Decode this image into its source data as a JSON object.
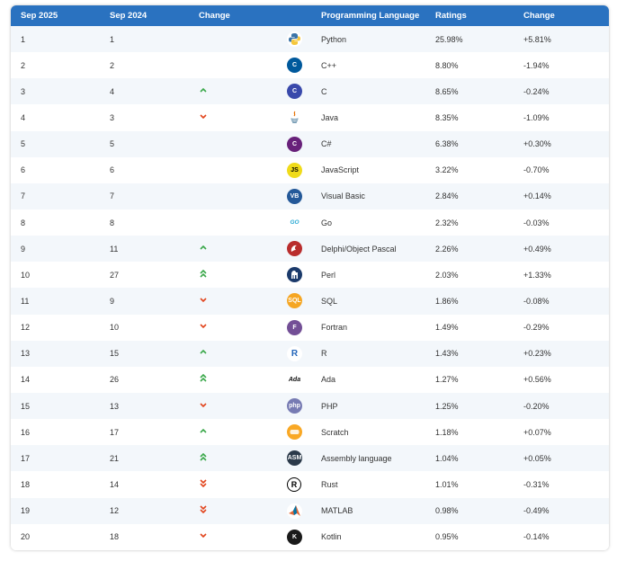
{
  "headers": {
    "sep2025": "Sep 2025",
    "sep2024": "Sep 2024",
    "change": "Change",
    "language": "Programming Language",
    "ratings": "Ratings",
    "ratings_change": "Change"
  },
  "colors": {
    "header_bg": "#2a72c0",
    "up": "#3aa84a",
    "down": "#e2441c"
  },
  "rows": [
    {
      "rank": "1",
      "prev": "1",
      "trend": "none",
      "icon": "python-icon",
      "lang": "Python",
      "rating": "25.98%",
      "change": "+5.81%"
    },
    {
      "rank": "2",
      "prev": "2",
      "trend": "none",
      "icon": "cpp-icon",
      "lang": "C++",
      "rating": "8.80%",
      "change": "-1.94%"
    },
    {
      "rank": "3",
      "prev": "4",
      "trend": "up",
      "icon": "c-icon",
      "lang": "C",
      "rating": "8.65%",
      "change": "-0.24%"
    },
    {
      "rank": "4",
      "prev": "3",
      "trend": "down",
      "icon": "java-icon",
      "lang": "Java",
      "rating": "8.35%",
      "change": "-1.09%"
    },
    {
      "rank": "5",
      "prev": "5",
      "trend": "none",
      "icon": "csharp-icon",
      "lang": "C#",
      "rating": "6.38%",
      "change": "+0.30%"
    },
    {
      "rank": "6",
      "prev": "6",
      "trend": "none",
      "icon": "javascript-icon",
      "lang": "JavaScript",
      "rating": "3.22%",
      "change": "-0.70%"
    },
    {
      "rank": "7",
      "prev": "7",
      "trend": "none",
      "icon": "visual-basic-icon",
      "lang": "Visual Basic",
      "rating": "2.84%",
      "change": "+0.14%"
    },
    {
      "rank": "8",
      "prev": "8",
      "trend": "none",
      "icon": "go-icon",
      "lang": "Go",
      "rating": "2.32%",
      "change": "-0.03%"
    },
    {
      "rank": "9",
      "prev": "11",
      "trend": "up",
      "icon": "delphi-icon",
      "lang": "Delphi/Object Pascal",
      "rating": "2.26%",
      "change": "+0.49%"
    },
    {
      "rank": "10",
      "prev": "27",
      "trend": "up2",
      "icon": "perl-icon",
      "lang": "Perl",
      "rating": "2.03%",
      "change": "+1.33%"
    },
    {
      "rank": "11",
      "prev": "9",
      "trend": "down",
      "icon": "sql-icon",
      "lang": "SQL",
      "rating": "1.86%",
      "change": "-0.08%"
    },
    {
      "rank": "12",
      "prev": "10",
      "trend": "down",
      "icon": "fortran-icon",
      "lang": "Fortran",
      "rating": "1.49%",
      "change": "-0.29%"
    },
    {
      "rank": "13",
      "prev": "15",
      "trend": "up",
      "icon": "r-icon",
      "lang": "R",
      "rating": "1.43%",
      "change": "+0.23%"
    },
    {
      "rank": "14",
      "prev": "26",
      "trend": "up2",
      "icon": "ada-icon",
      "lang": "Ada",
      "rating": "1.27%",
      "change": "+0.56%"
    },
    {
      "rank": "15",
      "prev": "13",
      "trend": "down",
      "icon": "php-icon",
      "lang": "PHP",
      "rating": "1.25%",
      "change": "-0.20%"
    },
    {
      "rank": "16",
      "prev": "17",
      "trend": "up",
      "icon": "scratch-icon",
      "lang": "Scratch",
      "rating": "1.18%",
      "change": "+0.07%"
    },
    {
      "rank": "17",
      "prev": "21",
      "trend": "up2",
      "icon": "assembly-icon",
      "lang": "Assembly language",
      "rating": "1.04%",
      "change": "+0.05%"
    },
    {
      "rank": "18",
      "prev": "14",
      "trend": "down2",
      "icon": "rust-icon",
      "lang": "Rust",
      "rating": "1.01%",
      "change": "-0.31%"
    },
    {
      "rank": "19",
      "prev": "12",
      "trend": "down2",
      "icon": "matlab-icon",
      "lang": "MATLAB",
      "rating": "0.98%",
      "change": "-0.49%"
    },
    {
      "rank": "20",
      "prev": "18",
      "trend": "down",
      "icon": "kotlin-icon",
      "lang": "Kotlin",
      "rating": "0.95%",
      "change": "-0.14%"
    }
  ],
  "logos": {
    "python-icon": {
      "text": "",
      "bg": "#ffffff"
    },
    "cpp-icon": {
      "text": "C",
      "bg": "#00599c"
    },
    "c-icon": {
      "text": "C",
      "bg": "#3949ab"
    },
    "java-icon": {
      "text": "",
      "bg": "#ffffff"
    },
    "csharp-icon": {
      "text": "C",
      "bg": "#68217a"
    },
    "javascript-icon": {
      "text": "JS",
      "bg": "#f0db1a"
    },
    "visual-basic-icon": {
      "text": "VB",
      "bg": "#245999"
    },
    "go-icon": {
      "text": "GO",
      "bg": "#ffffff"
    },
    "delphi-icon": {
      "text": "",
      "bg": "#b92d2d"
    },
    "perl-icon": {
      "text": "",
      "bg": "#1b3a6b"
    },
    "sql-icon": {
      "text": "SQL",
      "bg": "#f5a623"
    },
    "fortran-icon": {
      "text": "F",
      "bg": "#734f96"
    },
    "r-icon": {
      "text": "R",
      "bg": "#ffffff"
    },
    "ada-icon": {
      "text": "Ada",
      "bg": "#ffffff"
    },
    "php-icon": {
      "text": "php",
      "bg": "#777bb3"
    },
    "scratch-icon": {
      "text": "",
      "bg": "#f9a825"
    },
    "assembly-icon": {
      "text": "ASM",
      "bg": "#2b3a4a"
    },
    "rust-icon": {
      "text": "R",
      "bg": "#ffffff"
    },
    "matlab-icon": {
      "text": "",
      "bg": "#ffffff"
    },
    "kotlin-icon": {
      "text": "K",
      "bg": "#1a1a1a"
    }
  }
}
